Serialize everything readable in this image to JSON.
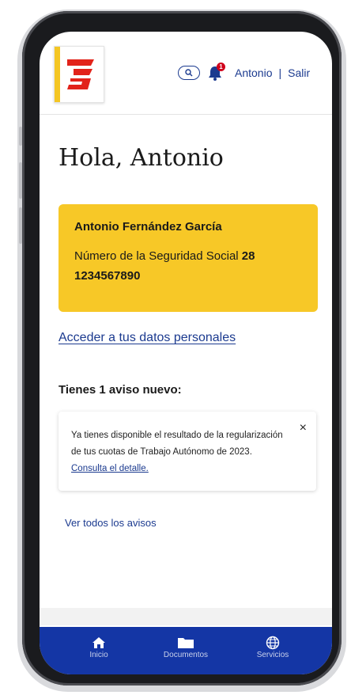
{
  "header": {
    "user_name": "Antonio",
    "separator": "|",
    "logout": "Salir",
    "notification_count": "1"
  },
  "greeting": "Hola, Antonio",
  "card": {
    "full_name": "Antonio Fernández García",
    "ss_label": "Número de la Seguridad Social",
    "ss_number": "28 1234567890"
  },
  "personal_data_link": "Acceder a tus datos personales",
  "notices": {
    "title": "Tienes 1 aviso nuevo:",
    "message": "Ya tienes disponible el resultado de la regularización de tus cuotas de Trabajo Autónomo de 2023.",
    "detail_link": "Consulta el detalle.",
    "close_symbol": "×",
    "all_link": "Ver todos los avisos"
  },
  "bottom_nav": [
    {
      "label": "Inicio",
      "icon": "home-icon"
    },
    {
      "label": "Documentos",
      "icon": "folder-icon"
    },
    {
      "label": "Servicios",
      "icon": "globe-icon"
    }
  ],
  "colors": {
    "brand_yellow": "#f7c827",
    "brand_red": "#e2231a",
    "link_blue": "#1b3a8f",
    "nav_blue": "#1436a5"
  }
}
